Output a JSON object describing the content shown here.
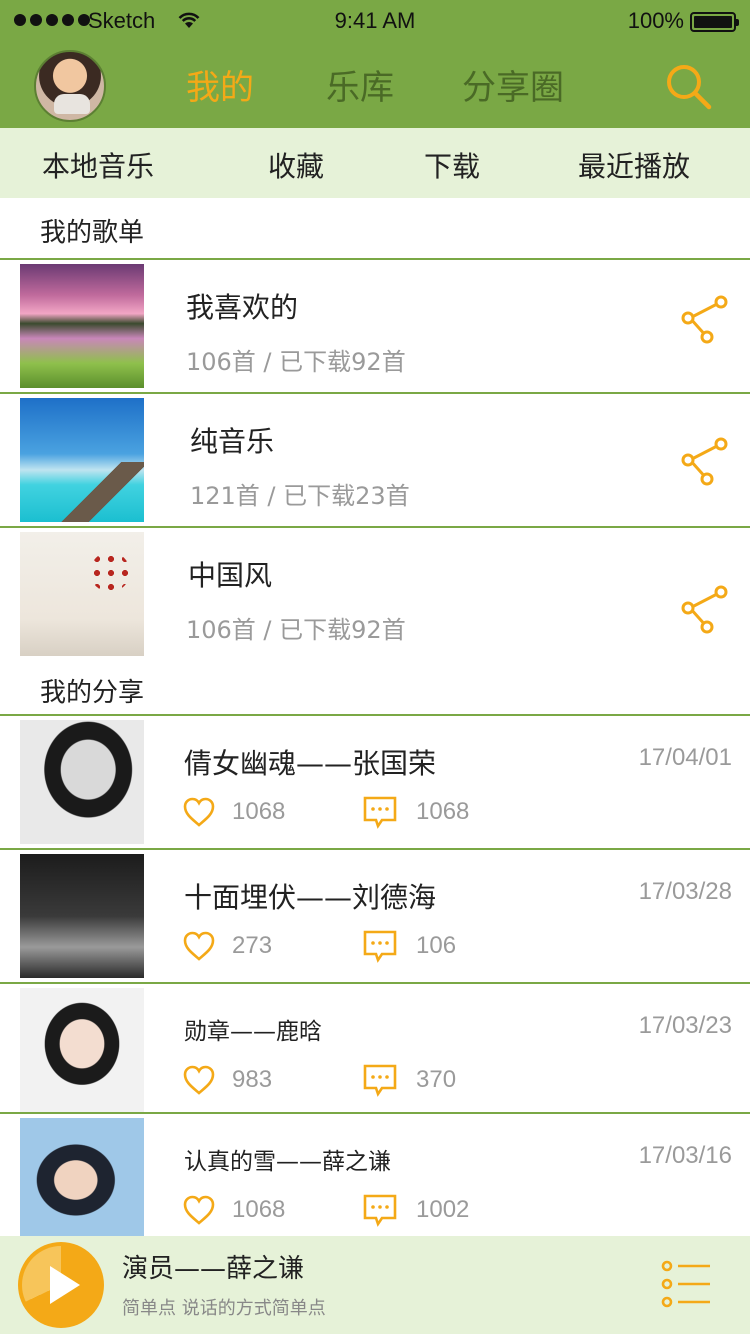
{
  "status_bar": {
    "carrier": "Sketch",
    "time": "9:41 AM",
    "battery": "100%"
  },
  "header": {
    "tabs": [
      {
        "label": "我的",
        "active": true
      },
      {
        "label": "乐库",
        "active": false
      },
      {
        "label": "分享圈",
        "active": false
      }
    ],
    "search_icon": "search-icon",
    "accent_color": "#f4a917",
    "brand_color": "#7aa845"
  },
  "subtabs": [
    "本地音乐",
    "收藏",
    "下载",
    "最近播放"
  ],
  "playlists_section": {
    "title": "我的歌单",
    "items": [
      {
        "title": "我喜欢的",
        "meta": "106首 / 已下载92首"
      },
      {
        "title": "纯音乐",
        "meta": "121首 / 已下载23首"
      },
      {
        "title": "中国风",
        "meta": "106首 / 已下载92首"
      }
    ]
  },
  "shares_section": {
    "title": "我的分享",
    "items": [
      {
        "title": "倩女幽魂——张国荣",
        "date": "17/04/01",
        "likes": "1068",
        "comments": "1068"
      },
      {
        "title": "十面埋伏——刘德海",
        "date": "17/03/28",
        "likes": "273",
        "comments": "106"
      },
      {
        "title": "勋章——鹿晗",
        "date": "17/03/23",
        "likes": "983",
        "comments": "370"
      },
      {
        "title": "认真的雪——薛之谦",
        "date": "17/03/16",
        "likes": "1068",
        "comments": "1002"
      }
    ]
  },
  "player": {
    "title": "演员——薛之谦",
    "subtitle": "简单点  说话的方式简单点",
    "progress": 0.68
  }
}
